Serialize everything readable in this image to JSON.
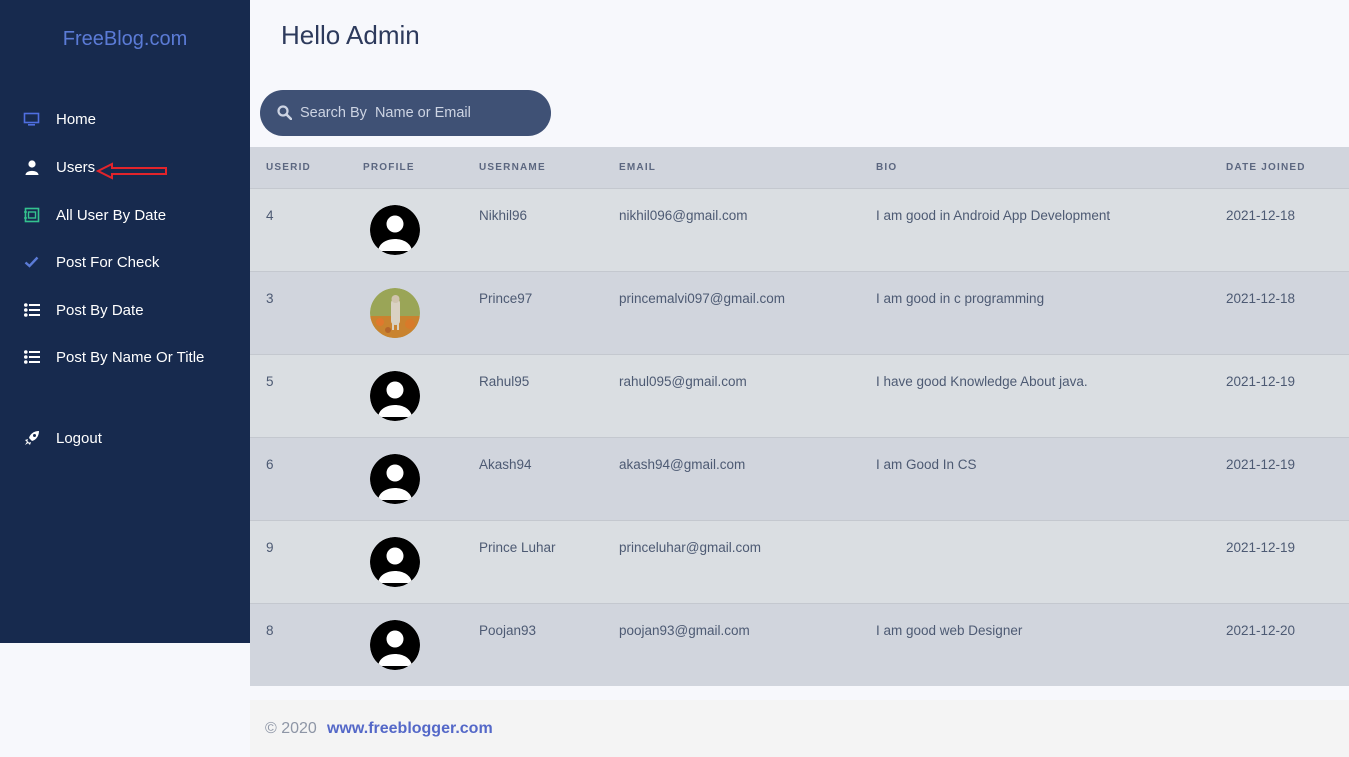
{
  "sidebar": {
    "brand": "FreeBlog.com",
    "items": [
      {
        "label": "Home",
        "icon": "monitor-icon"
      },
      {
        "label": "Users",
        "icon": "user-icon"
      },
      {
        "label": "All User By Date",
        "icon": "calendar-icon"
      },
      {
        "label": "Post For Check",
        "icon": "check-icon"
      },
      {
        "label": "Post By Date",
        "icon": "list-icon"
      },
      {
        "label": "Post By Name Or Title",
        "icon": "list-icon"
      },
      {
        "label": "Logout",
        "icon": "rocket-icon"
      }
    ]
  },
  "header": {
    "title": "Hello Admin"
  },
  "search": {
    "placeholder": "Search By  Name or Email"
  },
  "table": {
    "columns": [
      "USERID",
      "PROFILE",
      "USERNAME",
      "EMAIL",
      "BIO",
      "DATE JOINED"
    ],
    "rows": [
      {
        "userid": "4",
        "avatar": "default",
        "username": "Nikhil96",
        "email": "nikhil096@gmail.com",
        "bio": "I am good in Android App Development",
        "date": "2021-12-18"
      },
      {
        "userid": "3",
        "avatar": "photo",
        "username": "Prince97",
        "email": "princemalvi097@gmail.com",
        "bio": "I am good in c programming",
        "date": "2021-12-18"
      },
      {
        "userid": "5",
        "avatar": "default",
        "username": "Rahul95",
        "email": "rahul095@gmail.com",
        "bio": "I have good Knowledge About java.",
        "date": "2021-12-19"
      },
      {
        "userid": "6",
        "avatar": "default",
        "username": "Akash94",
        "email": "akash94@gmail.com",
        "bio": "I am Good In CS",
        "date": "2021-12-19"
      },
      {
        "userid": "9",
        "avatar": "default",
        "username": "Prince Luhar",
        "email": "princeluhar@gmail.com",
        "bio": "",
        "date": "2021-12-19"
      },
      {
        "userid": "8",
        "avatar": "default",
        "username": "Poojan93",
        "email": "poojan93@gmail.com",
        "bio": "I am good web Designer",
        "date": "2021-12-20"
      }
    ]
  },
  "footer": {
    "copyright": "© 2020",
    "link": "www.freeblogger.com"
  },
  "colors": {
    "sidebar_bg": "#172a4e",
    "brand": "#5b7bd6",
    "search_bg": "#3f5175",
    "link": "#5468c8",
    "annotation_arrow": "#e3242b"
  }
}
